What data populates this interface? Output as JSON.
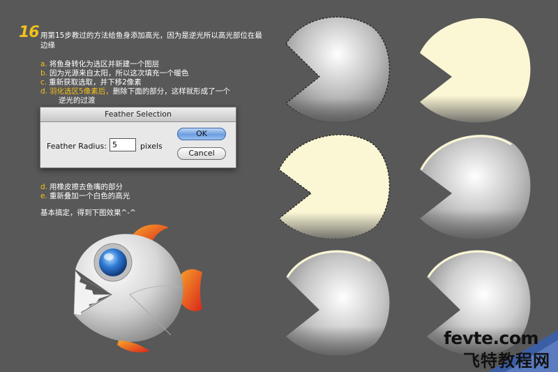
{
  "step_number": "16",
  "intro": "用第15步教过的方法给鱼身添加高光，因为是逆光所以高光部位在最边缘",
  "steps_top": [
    {
      "letter": "a.",
      "text": "将鱼身转化为选区并新建一个图层"
    },
    {
      "letter": "b.",
      "text": "因为光源来自太阳，所以这次填充一个暖色"
    },
    {
      "letter": "c.",
      "text": "重新获取选取，并下移2像素"
    },
    {
      "letter": "d.",
      "highlight": "羽化选区5像素后，",
      "text": "删除下面的部分，这样就形成了一个",
      "continuation": "逆光的过渡"
    }
  ],
  "steps_bottom": [
    {
      "letter": "d.",
      "text": "用橡皮擦去鱼嘴的部分"
    },
    {
      "letter": "e.",
      "text": "重新叠加一个白色的高光"
    }
  ],
  "summary": "基本搞定，得到下图效果^-^",
  "dialog": {
    "title": "Feather Selection",
    "field_label": "Feather Radius:",
    "field_value": "5",
    "units": "pixels",
    "ok_label": "OK",
    "cancel_label": "Cancel"
  },
  "watermark": {
    "line1": "fevte.com",
    "line2": "飞特教程网"
  },
  "colors": {
    "background": "#585858",
    "accent_yellow": "#f2c11b",
    "warm_fill": "#fbf6d4",
    "fin_red": "#e0301c",
    "fin_orange": "#f7a12a",
    "eye_blue": "#2b6fc9"
  }
}
